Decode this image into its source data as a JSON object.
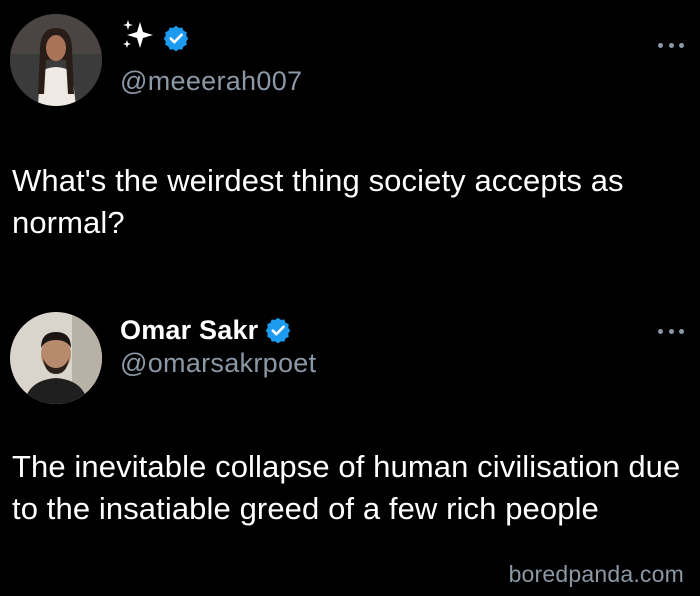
{
  "tweets": [
    {
      "display_name_icon": "sparkles-icon",
      "display_name_symbol": "✨",
      "verified": true,
      "handle": "@meeerah007",
      "text": "What's the weirdest thing society accepts as normal?"
    },
    {
      "display_name": "Omar Sakr",
      "verified": true,
      "handle": "@omarsakrpoet",
      "text": "The inevitable collapse of human civilisation due to the insatiable greed of a few rich people"
    }
  ],
  "watermark": "boredpanda.com",
  "colors": {
    "background": "#000000",
    "text": "#ffffff",
    "secondary": "#8b98a5",
    "verified_badge": "#1d9bf0"
  }
}
